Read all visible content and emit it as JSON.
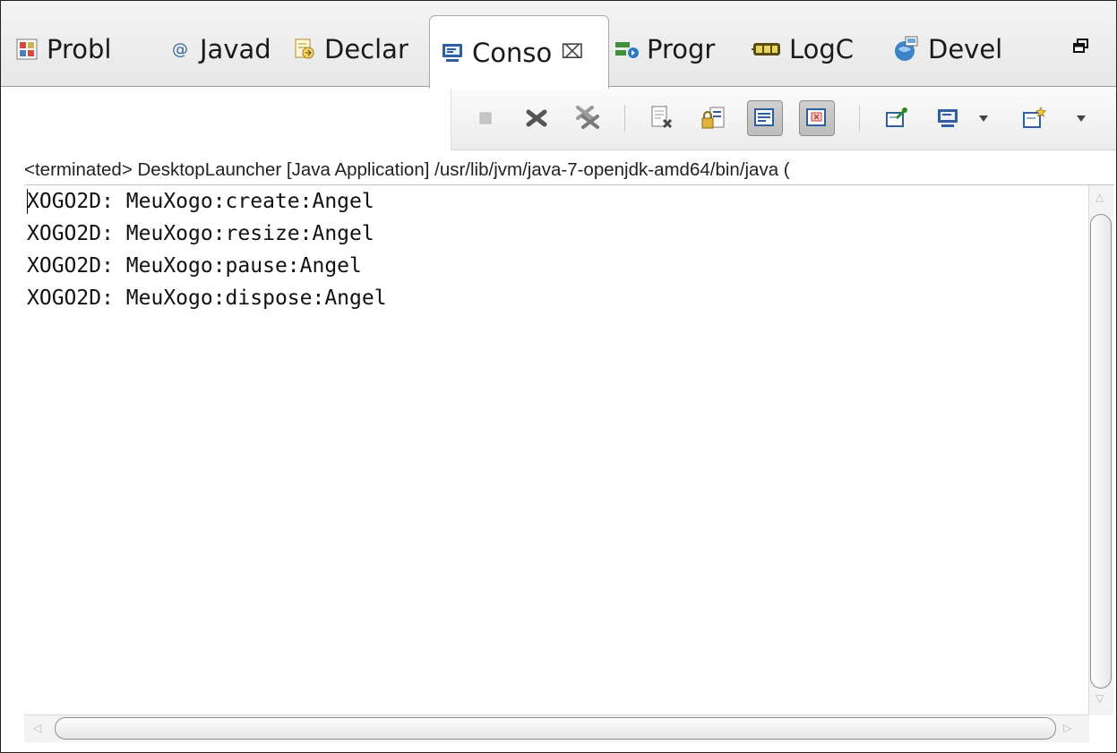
{
  "tabs": [
    {
      "label": "Probl",
      "icon": "problems-icon"
    },
    {
      "label": "Javad",
      "icon": "javadoc-icon",
      "glyph": "@"
    },
    {
      "label": "Declar",
      "icon": "declaration-icon"
    },
    {
      "label": "Conso",
      "icon": "console-icon",
      "active": true,
      "close_glyph": "⌧"
    },
    {
      "label": "Progr",
      "icon": "progress-icon"
    },
    {
      "label": "LogC",
      "icon": "logcat-icon"
    },
    {
      "label": "Devel",
      "icon": "devices-icon"
    }
  ],
  "toolbar": {
    "buttons": [
      "terminate-icon",
      "remove-launch-icon",
      "remove-all-terminated-icon",
      "clear-console-icon",
      "scroll-lock-icon",
      "show-on-stdout-icon",
      "show-on-stderr-icon",
      "pin-console-icon",
      "display-console-icon",
      "open-console-icon"
    ],
    "pressed": [
      "show-on-stdout-icon",
      "show-on-stderr-icon"
    ]
  },
  "launch_info": "<terminated> DesktopLauncher [Java Application] /usr/lib/jvm/java-7-openjdk-amd64/bin/java (",
  "console_lines": [
    "XOGO2D: MeuXogo:create:Angel",
    "XOGO2D: MeuXogo:resize:Angel",
    "XOGO2D: MeuXogo:pause:Angel",
    "XOGO2D: MeuXogo:dispose:Angel"
  ],
  "colors": {
    "active_tab_bg": "#ffffff",
    "tabbar_bg": "#ececec",
    "console_text": "#111111"
  }
}
